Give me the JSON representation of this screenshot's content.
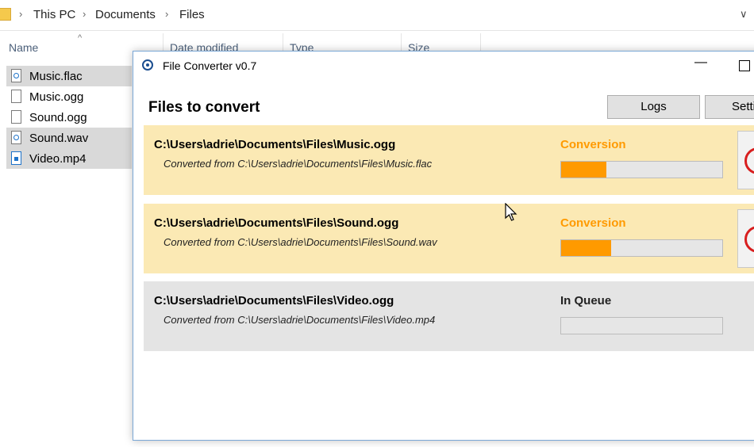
{
  "explorer": {
    "breadcrumb": [
      "This PC",
      "Documents",
      "Files"
    ],
    "columns": [
      "Name",
      "Date modified",
      "Type",
      "Size"
    ],
    "files": [
      {
        "name": "Music.flac",
        "kind": "audio",
        "selected": true
      },
      {
        "name": "Music.ogg",
        "kind": "blank",
        "selected": false
      },
      {
        "name": "Sound.ogg",
        "kind": "blank",
        "selected": false
      },
      {
        "name": "Sound.wav",
        "kind": "audio",
        "selected": true
      },
      {
        "name": "Video.mp4",
        "kind": "video",
        "selected": true
      }
    ]
  },
  "converter": {
    "title": "File Converter v0.7",
    "heading": "Files to convert",
    "buttons": {
      "logs": "Logs",
      "settings": "Setti"
    },
    "jobs": [
      {
        "path": "C:\\Users\\adrie\\Documents\\Files\\Music.ogg",
        "from": "Converted from C:\\Users\\adrie\\Documents\\Files\\Music.flac",
        "status": "Conversion",
        "progress": 0.28
      },
      {
        "path": "C:\\Users\\adrie\\Documents\\Files\\Sound.ogg",
        "from": "Converted from C:\\Users\\adrie\\Documents\\Files\\Sound.wav",
        "status": "Conversion",
        "progress": 0.31
      },
      {
        "path": "C:\\Users\\adrie\\Documents\\Files\\Video.ogg",
        "from": "Converted from C:\\Users\\adrie\\Documents\\Files\\Video.mp4",
        "status": "In Queue",
        "progress": 0
      }
    ]
  },
  "colors": {
    "accent": "#ff9a00",
    "active_card": "#fbe9b4",
    "queued_card": "#e4e4e4",
    "cancel": "#d81e1e"
  }
}
